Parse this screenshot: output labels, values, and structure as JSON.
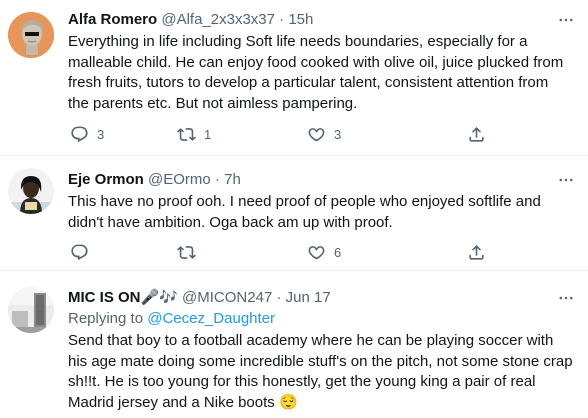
{
  "tweets": [
    {
      "name": "Alfa Romero",
      "handle": "@Alfa_2x3x3x37",
      "dot": "·",
      "time": "15h",
      "text": "Everything in life including Soft life needs boundaries, especially for a malleable child. He can enjoy food cooked with olive oil, juice plucked from fresh fruits, tutors to develop a particular talent, consistent attention from the parents etc. But not aimless pampering.",
      "reply_count": "3",
      "retweet_count": "1",
      "like_count": "3"
    },
    {
      "name": "Eje Ormon",
      "handle": "@EOrmo",
      "dot": "·",
      "time": "7h",
      "text": "This have no proof ooh. I need proof of people who enjoyed softlife and didn't have ambition. Oga back am up with proof.",
      "reply_count": "",
      "retweet_count": "",
      "like_count": "6"
    },
    {
      "name": "MIC IS ON🎤🎶",
      "handle": "@MICON247",
      "dot": "·",
      "time": "Jun 17",
      "replying_prefix": "Replying to",
      "replying_to": "@Cecez_Daughter",
      "text": "Send that boy to a football academy where he can be playing soccer with his age mate doing some incredible stuff's on the pitch, not some stone crap sh!!t. He is too young for this honestly, get the young king a pair of real Madrid jersey and a Nike boots 😌"
    }
  ],
  "colors": {
    "text_primary": "#0f1419",
    "text_secondary": "#536471",
    "link": "#1d9bf0",
    "separator": "#eff3f4"
  },
  "icons": {
    "reply": "reply-icon",
    "retweet": "retweet-icon",
    "like": "like-icon",
    "share": "share-icon",
    "more": "more-icon"
  }
}
